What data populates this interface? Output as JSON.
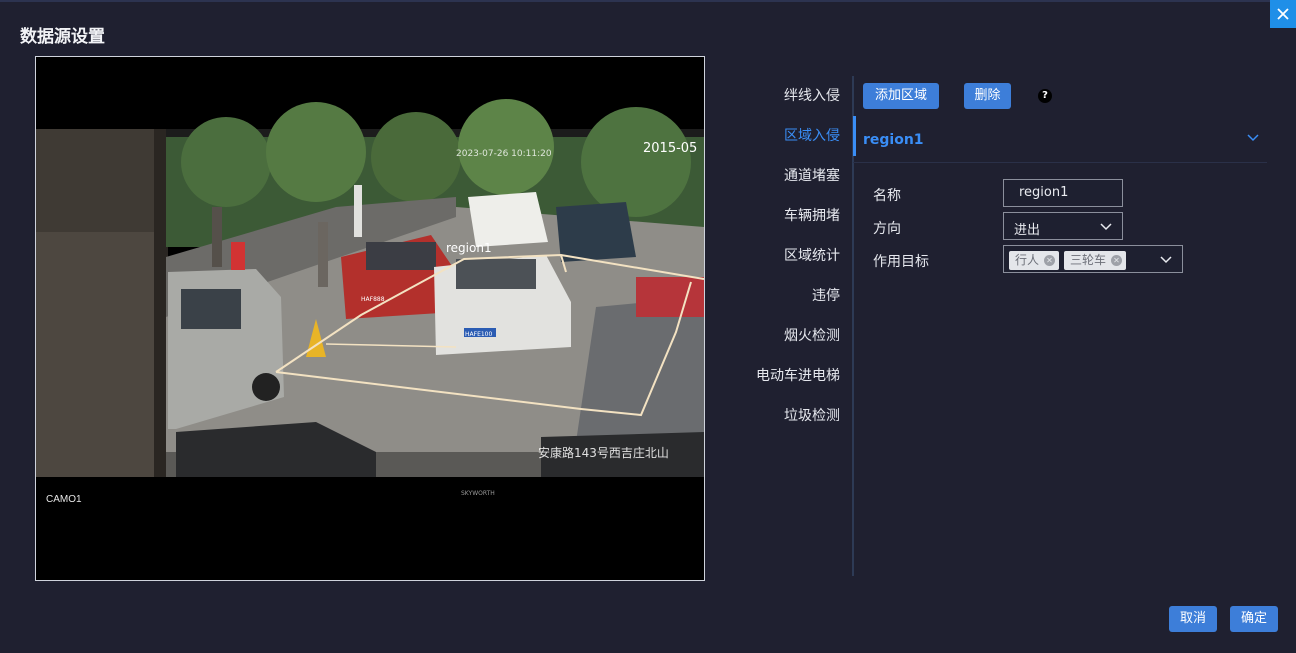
{
  "dialog": {
    "title": "数据源设置",
    "close_icon": "close-icon"
  },
  "video": {
    "camera_label": "CAMO1",
    "overlay_region_label": "region1",
    "overlay_timestamp": "2023-07-26 10:11:20",
    "overlay_date": "2015-05",
    "overlay_location": "安康路143号西吉庄北山",
    "plate_1": "HAFE100",
    "plate_2": "HAF888",
    "brand": "SKYWORTH"
  },
  "nav": {
    "items": [
      {
        "label": "绊线入侵",
        "active": false
      },
      {
        "label": "区域入侵",
        "active": true
      },
      {
        "label": "通道堵塞",
        "active": false
      },
      {
        "label": "车辆拥堵",
        "active": false
      },
      {
        "label": "区域统计",
        "active": false
      },
      {
        "label": "违停",
        "active": false
      },
      {
        "label": "烟火检测",
        "active": false
      },
      {
        "label": "电动车进电梯",
        "active": false
      },
      {
        "label": "垃圾检测",
        "active": false
      }
    ]
  },
  "toolbar": {
    "add_region": "添加区域",
    "delete": "删除",
    "help_icon": "question-icon"
  },
  "region": {
    "title": "region1",
    "expand_icon": "chevron-down-icon",
    "fields": {
      "name_label": "名称",
      "name_value": "region1",
      "direction_label": "方向",
      "direction_value": "进出",
      "target_label": "作用目标",
      "targets": [
        "行人",
        "三轮车"
      ]
    }
  },
  "footer": {
    "cancel": "取消",
    "confirm": "确定"
  },
  "colors": {
    "background": "#1f2030",
    "accent": "#3a8ef6",
    "button": "#3d7ed9",
    "close_button": "#1f8fe8"
  }
}
